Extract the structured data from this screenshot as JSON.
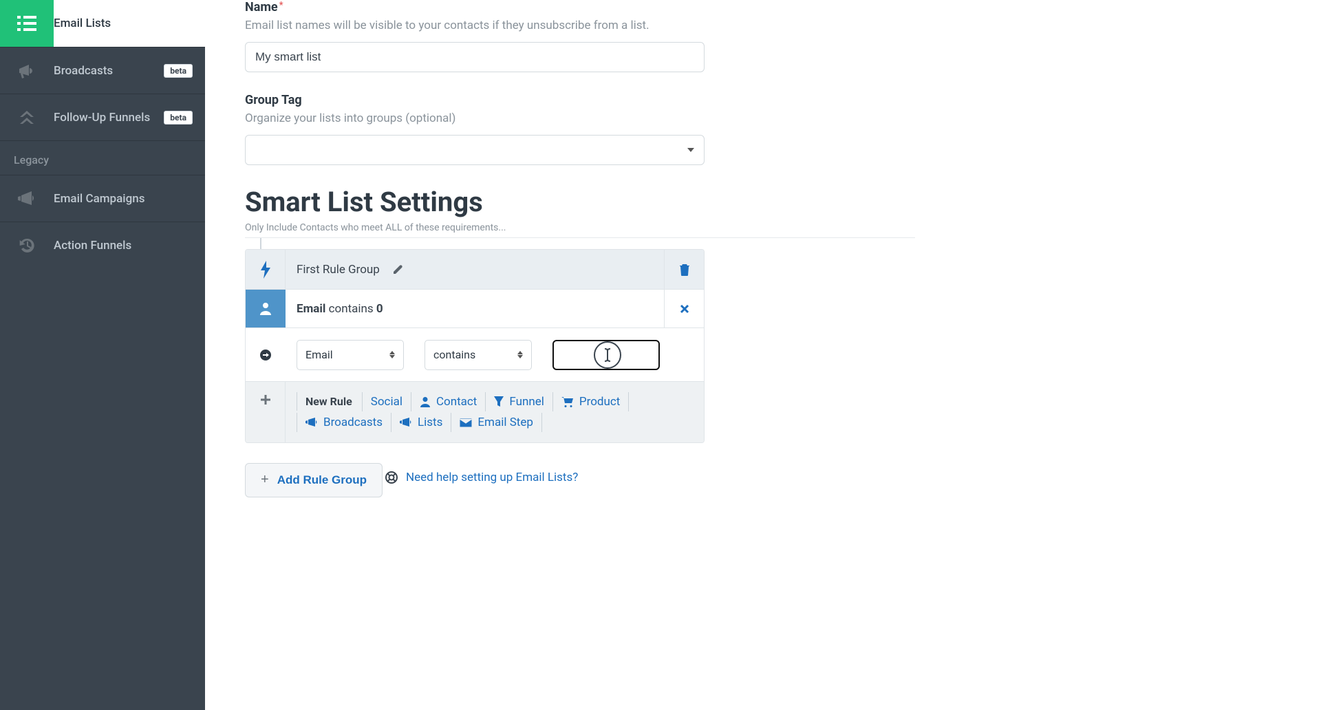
{
  "sidebar": {
    "items": [
      {
        "label": "Email Lists"
      },
      {
        "label": "Broadcasts",
        "badge": "beta"
      },
      {
        "label": "Follow-Up Funnels",
        "badge": "beta"
      }
    ],
    "legacy_label": "Legacy",
    "legacy_items": [
      {
        "label": "Email Campaigns"
      },
      {
        "label": "Action Funnels"
      }
    ]
  },
  "form": {
    "name": {
      "label": "Name",
      "help": "Email list names will be visible to your contacts if they unsubscribe from a list.",
      "value": "My smart list"
    },
    "group_tag": {
      "label": "Group Tag",
      "help": "Organize your lists into groups (optional)",
      "value": ""
    }
  },
  "smart": {
    "title": "Smart List Settings",
    "subtitle": "Only Include Contacts who meet ALL of these requirements...",
    "group_title": "First Rule Group",
    "condition": {
      "field": "Email",
      "op": "contains",
      "count": "0"
    },
    "editor": {
      "field": "Email",
      "op": "contains",
      "value": ""
    },
    "new_rule_label": "New Rule",
    "rule_types": {
      "social": "Social",
      "contact": "Contact",
      "funnel": "Funnel",
      "product": "Product",
      "broadcasts": "Broadcasts",
      "lists": "Lists",
      "email_step": "Email Step"
    },
    "add_group": "Add Rule Group"
  },
  "help_link": "Need help setting up Email Lists?"
}
